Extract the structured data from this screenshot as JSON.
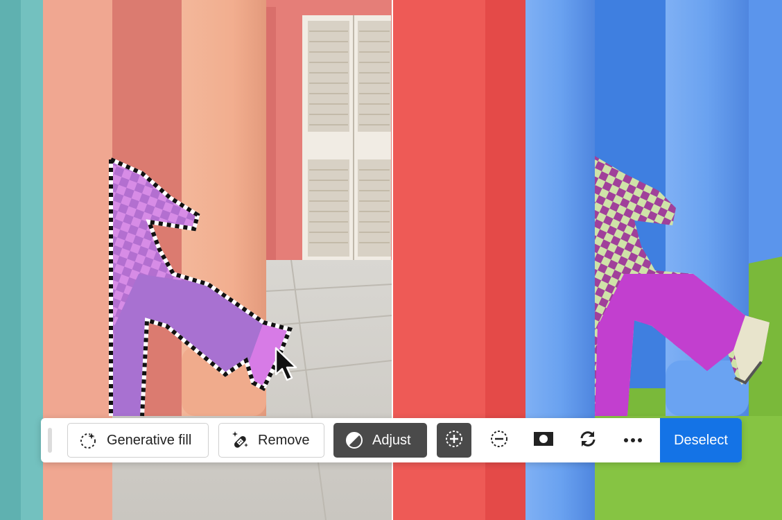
{
  "toolbar": {
    "buttons": {
      "generative_fill": "Generative fill",
      "remove": "Remove",
      "adjust": "Adjust",
      "deselect": "Deselect"
    },
    "icons": {
      "generative_fill": "sparkle-selection-icon",
      "remove": "bandage-sparkle-icon",
      "adjust": "half-circle-adjust-icon",
      "add_selection": "add-selection-icon",
      "subtract_selection": "subtract-selection-icon",
      "mask": "mask-icon",
      "invert": "refresh-arrows-icon",
      "more": "more-options-icon"
    },
    "colors": {
      "accent": "#1473e6",
      "dark_button": "#4a4a4a"
    }
  },
  "scene": {
    "left_panel_tint": "#f0a58c",
    "right_panel_tint": "#5b92ea",
    "selection_outline": "dashed black and white marching ants around figure"
  }
}
